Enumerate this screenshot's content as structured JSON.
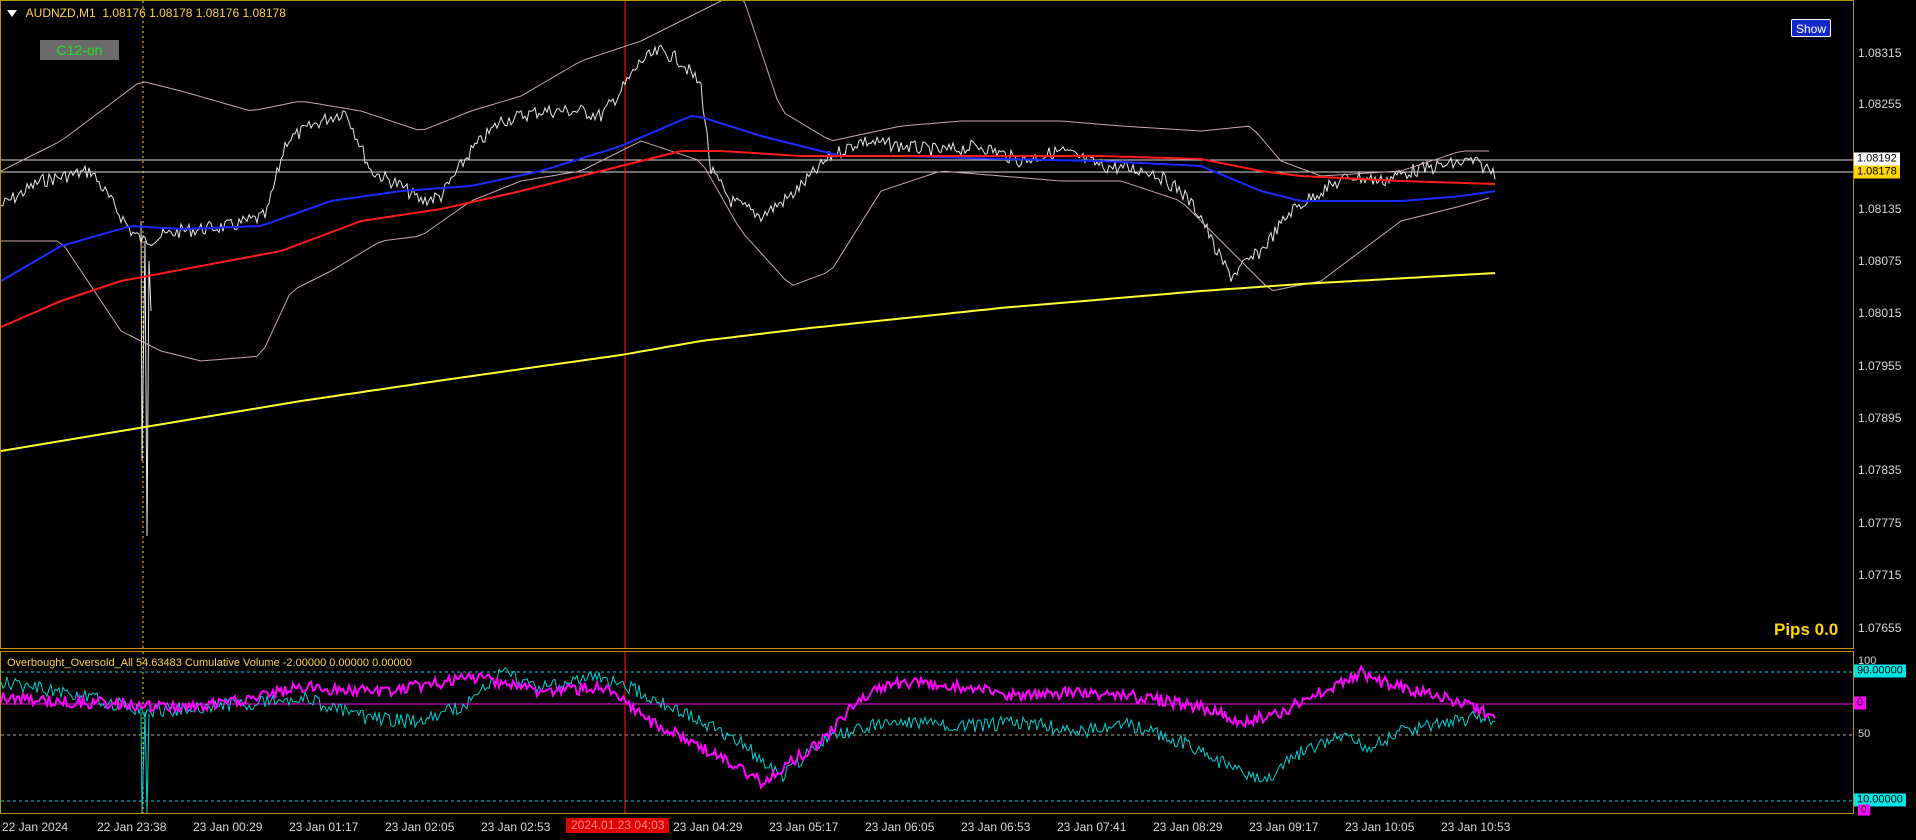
{
  "chart_header": {
    "symbol": "AUDNZD,M1",
    "ohlc": "1.08176 1.08178 1.08176 1.08178",
    "dropdown_icon": "triangle-down-icon"
  },
  "badge": {
    "label": "C12-on"
  },
  "show_button": {
    "label": "Show",
    "color": "#1428c8"
  },
  "pips": {
    "label": "Pips 0.0"
  },
  "price_axis": {
    "ticks": [
      "1.08315",
      "1.08255",
      "1.08192",
      "1.08135",
      "1.08075",
      "1.08015",
      "1.07955",
      "1.07895",
      "1.07835",
      "1.07775",
      "1.07715",
      "1.07655"
    ],
    "tags": [
      {
        "label": "1.08192",
        "bg": "#ffffff"
      },
      {
        "label": "1.08178",
        "bg": "#ffd700"
      }
    ]
  },
  "indicator": {
    "header": "Overbought_Oversold_All 54.63483  Cumulative Volume -2.00000 0.00000 0.00000",
    "axis_labels": [
      "100",
      "50",
      "0"
    ],
    "tags": [
      {
        "label": "90.00000",
        "bg": "#00e5e5"
      },
      {
        "label": "0",
        "bg": "#ff00ff"
      },
      {
        "label": "10.00000",
        "bg": "#00e5e5"
      }
    ]
  },
  "time_axis": {
    "ticks": [
      "22 Jan 2024",
      "22 Jan 23:38",
      "23 Jan 00:29",
      "23 Jan 01:17",
      "23 Jan 02:05",
      "23 Jan 02:53",
      "23 Jan 04:29",
      "23 Jan 05:17",
      "23 Jan 06:05",
      "23 Jan 06:53",
      "23 Jan 07:41",
      "23 Jan 08:29",
      "23 Jan 09:17",
      "23 Jan 10:05",
      "23 Jan 10:53"
    ],
    "highlight": "2024.01.23 04:03"
  },
  "colors": {
    "price": "#e6e6e6",
    "ma_fast": "#1a2cff",
    "ma_slow": "#ff1a1a",
    "ma_long": "#ffff33",
    "bands": "#c8a8a8",
    "osc_cyan": "#00d0d0",
    "osc_magenta": "#ff00ff",
    "frame": "#b8960c"
  }
}
